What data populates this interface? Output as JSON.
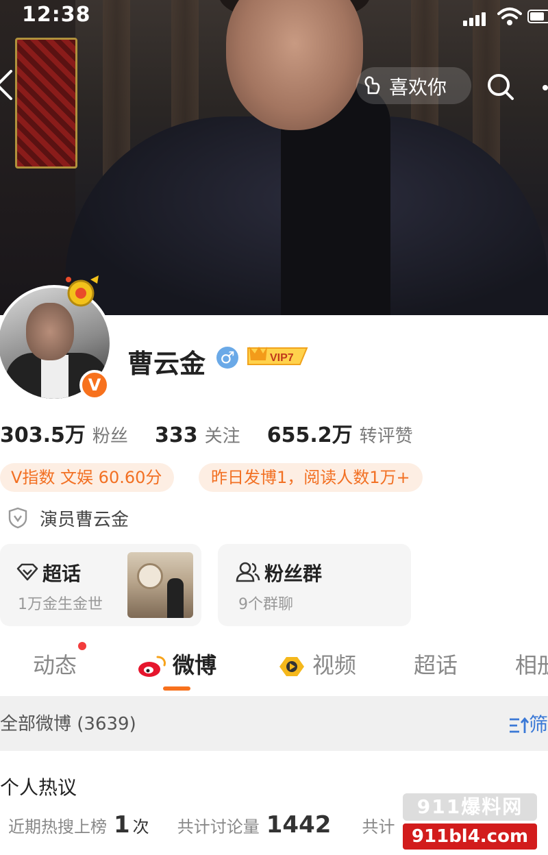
{
  "status_bar": {
    "time": "12:38"
  },
  "header": {
    "like_label": "喜欢你"
  },
  "profile": {
    "name": "曹云金",
    "vip_label": "VIP7",
    "verify_mark": "V"
  },
  "stats": [
    {
      "value": "303.5万",
      "label": "粉丝"
    },
    {
      "value": "333",
      "label": "关注"
    },
    {
      "value": "655.2万",
      "label": "转评赞"
    }
  ],
  "chips": {
    "vindex": "V指数 文娱 60.60分",
    "post": "昨日发博1，阅读人数1万+"
  },
  "identity": "演员曹云金",
  "tiles": {
    "topic": {
      "title": "超话",
      "subtitle": "1万金生金世"
    },
    "fans": {
      "title": "粉丝群",
      "subtitle": "9个群聊"
    }
  },
  "tabs": [
    {
      "label": "动态"
    },
    {
      "label": "微博"
    },
    {
      "label": "视频"
    },
    {
      "label": "超话"
    },
    {
      "label": "相册"
    }
  ],
  "feed": {
    "all_label": "全部微博 (3639)",
    "filter_label": "筛选",
    "section_title": "个人热议",
    "hot_items": [
      {
        "label": "近期热搜上榜",
        "value": "1",
        "unit": "次"
      },
      {
        "label": "共计讨论量",
        "value": "1442",
        "unit": ""
      },
      {
        "label": "共计",
        "value": "",
        "unit": ""
      }
    ]
  },
  "watermark": {
    "top": "911爆料网",
    "bottom": "911bl4.com"
  },
  "colors": {
    "accent": "#f7711d",
    "chip_bg": "#fdeee3",
    "link": "#3a78d6"
  }
}
